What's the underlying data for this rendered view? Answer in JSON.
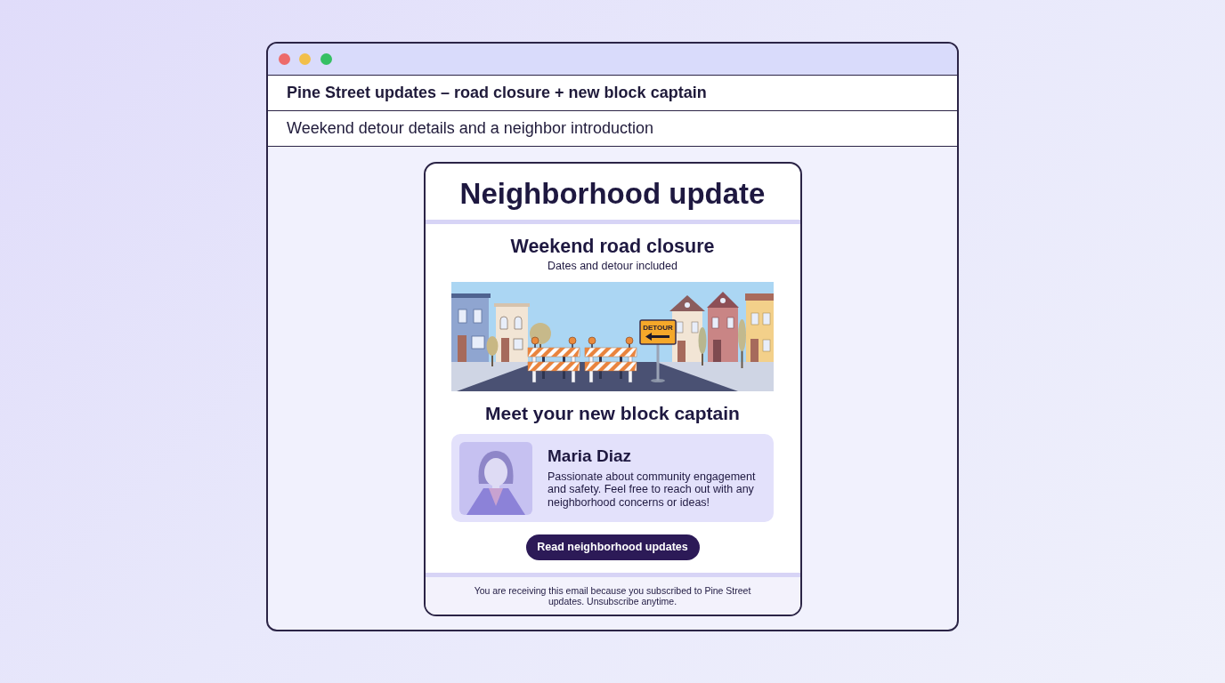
{
  "window": {
    "controls": [
      {
        "color": "#ed6a6a"
      },
      {
        "color": "#f2bf4a"
      },
      {
        "color": "#35c063"
      }
    ]
  },
  "email": {
    "subject": "Pine Street updates – road closure + new block captain",
    "preview": "Weekend detour details and a neighbor introduction"
  },
  "newsletter": {
    "title": "Neighborhood update",
    "closure": {
      "heading": "Weekend road closure",
      "subheading": "Dates and detour included",
      "sign": "DETOUR"
    },
    "captain": {
      "heading": "Meet your new block captain",
      "name": "Maria Diaz",
      "bio": "Passionate about community engagement and safety. Feel free to reach out with any neighborhood concerns or ideas!"
    },
    "button": "Read neighborhood updates",
    "footer": "You are receiving this email because you subscribed to Pine Street updates. Unsubscribe anytime."
  }
}
